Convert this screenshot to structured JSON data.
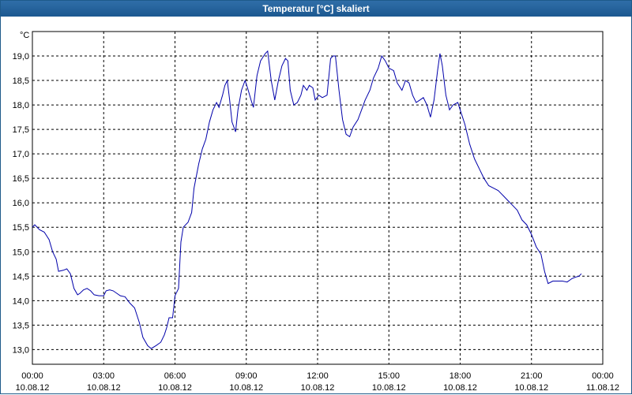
{
  "window": {
    "title": "Temperatur [°C] skaliert"
  },
  "chart_data": {
    "type": "line",
    "title": "Temperatur [°C] skaliert",
    "ylabel": "°C",
    "xlabel": "",
    "ylim": [
      12.7,
      19.5
    ],
    "xlim": [
      0,
      24
    ],
    "grid": true,
    "line_color": "#0000aa",
    "y_ticks": [
      {
        "value": 13.0,
        "label": "13,0"
      },
      {
        "value": 13.5,
        "label": "13,5"
      },
      {
        "value": 14.0,
        "label": "14,0"
      },
      {
        "value": 14.5,
        "label": "14,5"
      },
      {
        "value": 15.0,
        "label": "15,0"
      },
      {
        "value": 15.5,
        "label": "15,5"
      },
      {
        "value": 16.0,
        "label": "16,0"
      },
      {
        "value": 16.5,
        "label": "16,5"
      },
      {
        "value": 17.0,
        "label": "17,0"
      },
      {
        "value": 17.5,
        "label": "17,5"
      },
      {
        "value": 18.0,
        "label": "18,0"
      },
      {
        "value": 18.5,
        "label": "18,5"
      },
      {
        "value": 19.0,
        "label": "19,0"
      }
    ],
    "x_ticks": [
      {
        "value": 0,
        "time": "00:00",
        "date": "10.08.12"
      },
      {
        "value": 3,
        "time": "03:00",
        "date": "10.08.12"
      },
      {
        "value": 6,
        "time": "06:00",
        "date": "10.08.12"
      },
      {
        "value": 9,
        "time": "09:00",
        "date": "10.08.12"
      },
      {
        "value": 12,
        "time": "12:00",
        "date": "10.08.12"
      },
      {
        "value": 15,
        "time": "15:00",
        "date": "10.08.12"
      },
      {
        "value": 18,
        "time": "18:00",
        "date": "10.08.12"
      },
      {
        "value": 21,
        "time": "21:00",
        "date": "10.08.12"
      },
      {
        "value": 24,
        "time": "00:00",
        "date": "11.08.12"
      }
    ],
    "series": [
      {
        "points": [
          [
            0.0,
            15.5
          ],
          [
            0.1,
            15.55
          ],
          [
            0.3,
            15.45
          ],
          [
            0.5,
            15.4
          ],
          [
            0.7,
            15.25
          ],
          [
            0.85,
            15.0
          ],
          [
            1.0,
            14.85
          ],
          [
            1.1,
            14.6
          ],
          [
            1.3,
            14.62
          ],
          [
            1.45,
            14.65
          ],
          [
            1.6,
            14.55
          ],
          [
            1.75,
            14.25
          ],
          [
            1.9,
            14.12
          ],
          [
            2.0,
            14.15
          ],
          [
            2.15,
            14.22
          ],
          [
            2.3,
            14.25
          ],
          [
            2.45,
            14.2
          ],
          [
            2.6,
            14.12
          ],
          [
            2.8,
            14.1
          ],
          [
            3.0,
            14.1
          ],
          [
            3.1,
            14.2
          ],
          [
            3.25,
            14.22
          ],
          [
            3.4,
            14.2
          ],
          [
            3.55,
            14.15
          ],
          [
            3.7,
            14.1
          ],
          [
            3.9,
            14.08
          ],
          [
            4.1,
            13.95
          ],
          [
            4.3,
            13.85
          ],
          [
            4.5,
            13.55
          ],
          [
            4.65,
            13.25
          ],
          [
            4.85,
            13.08
          ],
          [
            5.0,
            13.02
          ],
          [
            5.2,
            13.08
          ],
          [
            5.4,
            13.15
          ],
          [
            5.55,
            13.3
          ],
          [
            5.65,
            13.45
          ],
          [
            5.75,
            13.65
          ],
          [
            5.9,
            13.65
          ],
          [
            6.0,
            14.1
          ],
          [
            6.15,
            14.25
          ],
          [
            6.25,
            15.2
          ],
          [
            6.35,
            15.5
          ],
          [
            6.55,
            15.6
          ],
          [
            6.7,
            15.8
          ],
          [
            6.8,
            16.3
          ],
          [
            7.0,
            16.8
          ],
          [
            7.15,
            17.1
          ],
          [
            7.3,
            17.3
          ],
          [
            7.45,
            17.65
          ],
          [
            7.6,
            17.9
          ],
          [
            7.75,
            18.05
          ],
          [
            7.85,
            17.95
          ],
          [
            8.0,
            18.2
          ],
          [
            8.1,
            18.4
          ],
          [
            8.2,
            18.5
          ],
          [
            8.3,
            18.1
          ],
          [
            8.4,
            17.65
          ],
          [
            8.55,
            17.45
          ],
          [
            8.65,
            17.9
          ],
          [
            8.8,
            18.3
          ],
          [
            8.95,
            18.5
          ],
          [
            9.05,
            18.35
          ],
          [
            9.2,
            18.1
          ],
          [
            9.3,
            17.95
          ],
          [
            9.45,
            18.6
          ],
          [
            9.6,
            18.9
          ],
          [
            9.8,
            19.05
          ],
          [
            9.9,
            19.1
          ],
          [
            10.05,
            18.5
          ],
          [
            10.2,
            18.1
          ],
          [
            10.35,
            18.5
          ],
          [
            10.5,
            18.8
          ],
          [
            10.65,
            18.95
          ],
          [
            10.75,
            18.9
          ],
          [
            10.85,
            18.3
          ],
          [
            11.0,
            18.0
          ],
          [
            11.15,
            18.05
          ],
          [
            11.3,
            18.2
          ],
          [
            11.4,
            18.4
          ],
          [
            11.55,
            18.3
          ],
          [
            11.65,
            18.4
          ],
          [
            11.8,
            18.35
          ],
          [
            11.9,
            18.1
          ],
          [
            12.05,
            18.2
          ],
          [
            12.2,
            18.15
          ],
          [
            12.4,
            18.2
          ],
          [
            12.55,
            18.95
          ],
          [
            12.65,
            19.0
          ],
          [
            12.75,
            19.0
          ],
          [
            12.9,
            18.3
          ],
          [
            13.05,
            17.7
          ],
          [
            13.2,
            17.4
          ],
          [
            13.35,
            17.35
          ],
          [
            13.5,
            17.55
          ],
          [
            13.7,
            17.7
          ],
          [
            13.85,
            17.9
          ],
          [
            14.0,
            18.1
          ],
          [
            14.2,
            18.3
          ],
          [
            14.35,
            18.55
          ],
          [
            14.55,
            18.75
          ],
          [
            14.7,
            19.0
          ],
          [
            14.85,
            18.9
          ],
          [
            15.0,
            18.75
          ],
          [
            15.2,
            18.7
          ],
          [
            15.35,
            18.45
          ],
          [
            15.55,
            18.3
          ],
          [
            15.7,
            18.5
          ],
          [
            15.85,
            18.45
          ],
          [
            16.0,
            18.2
          ],
          [
            16.15,
            18.05
          ],
          [
            16.3,
            18.1
          ],
          [
            16.45,
            18.15
          ],
          [
            16.6,
            18.0
          ],
          [
            16.75,
            17.75
          ],
          [
            16.9,
            18.1
          ],
          [
            17.05,
            18.7
          ],
          [
            17.15,
            19.05
          ],
          [
            17.25,
            18.8
          ],
          [
            17.4,
            18.2
          ],
          [
            17.55,
            17.9
          ],
          [
            17.7,
            18.0
          ],
          [
            17.9,
            18.05
          ],
          [
            18.0,
            17.9
          ],
          [
            18.2,
            17.6
          ],
          [
            18.4,
            17.2
          ],
          [
            18.6,
            16.9
          ],
          [
            18.8,
            16.7
          ],
          [
            19.0,
            16.5
          ],
          [
            19.2,
            16.35
          ],
          [
            19.4,
            16.3
          ],
          [
            19.6,
            16.25
          ],
          [
            19.8,
            16.15
          ],
          [
            20.0,
            16.05
          ],
          [
            20.2,
            15.95
          ],
          [
            20.4,
            15.85
          ],
          [
            20.6,
            15.65
          ],
          [
            20.8,
            15.55
          ],
          [
            21.0,
            15.35
          ],
          [
            21.2,
            15.1
          ],
          [
            21.4,
            14.95
          ],
          [
            21.55,
            14.6
          ],
          [
            21.7,
            14.35
          ],
          [
            21.9,
            14.4
          ],
          [
            22.1,
            14.4
          ],
          [
            22.3,
            14.4
          ],
          [
            22.5,
            14.38
          ],
          [
            22.7,
            14.45
          ],
          [
            22.85,
            14.48
          ],
          [
            23.0,
            14.5
          ],
          [
            23.1,
            14.55
          ]
        ]
      }
    ]
  }
}
